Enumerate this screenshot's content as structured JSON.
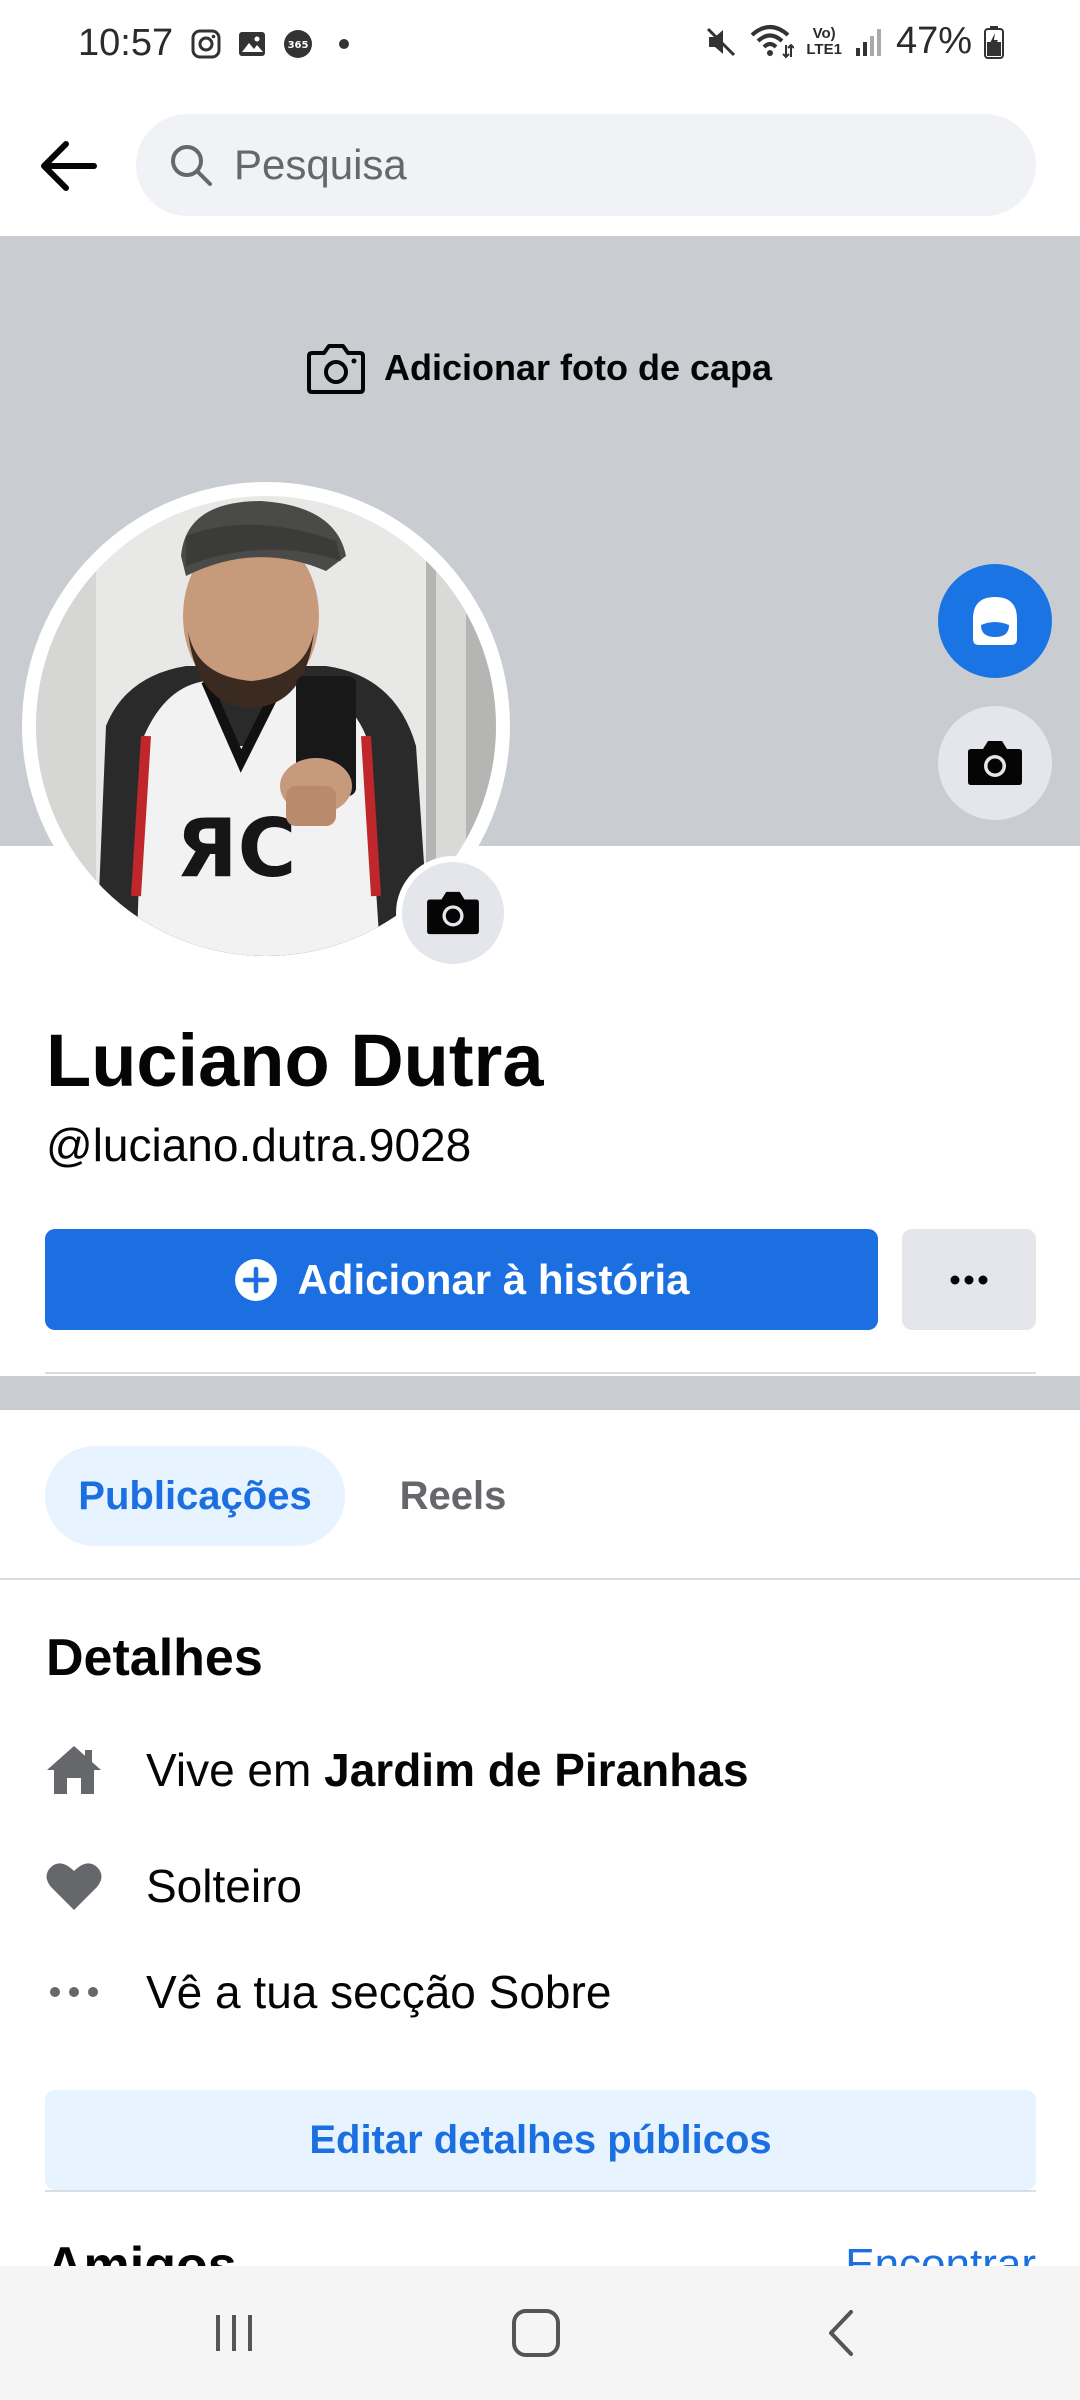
{
  "status_bar": {
    "time": "10:57",
    "battery": "47%",
    "lte_label_top": "Vo)",
    "lte_label_bottom": "LTE1",
    "left_icons": [
      "instagram-icon",
      "gallery-icon",
      "365-app-icon",
      "dot-icon"
    ],
    "right_icons": [
      "mute-icon",
      "wifi-icon",
      "lte-icon",
      "signal-icon",
      "battery-icon"
    ]
  },
  "header": {
    "back_icon": "arrow-left-icon",
    "search_placeholder": "Pesquisa"
  },
  "cover": {
    "add_cover_label": "Adicionar foto de capa",
    "color": "#c9ccd1"
  },
  "profile": {
    "name": "Luciano Dutra",
    "username": "@luciano.dutra.9028"
  },
  "actions": {
    "add_story_label": "Adicionar à história",
    "more_icon": "more-dots-icon",
    "accent_color": "#1b6fe0"
  },
  "tabs": [
    {
      "label": "Publicações",
      "active": true
    },
    {
      "label": "Reels",
      "active": false
    }
  ],
  "details": {
    "title": "Detalhes",
    "lives_prefix": "Vive em",
    "lives_place": "Jardim de Piranhas",
    "relationship": "Solteiro",
    "about_link": "Vê a tua secção Sobre",
    "edit_button": "Editar detalhes públicos"
  },
  "friends": {
    "title": "Amigos",
    "find_link": "Encontrar"
  }
}
